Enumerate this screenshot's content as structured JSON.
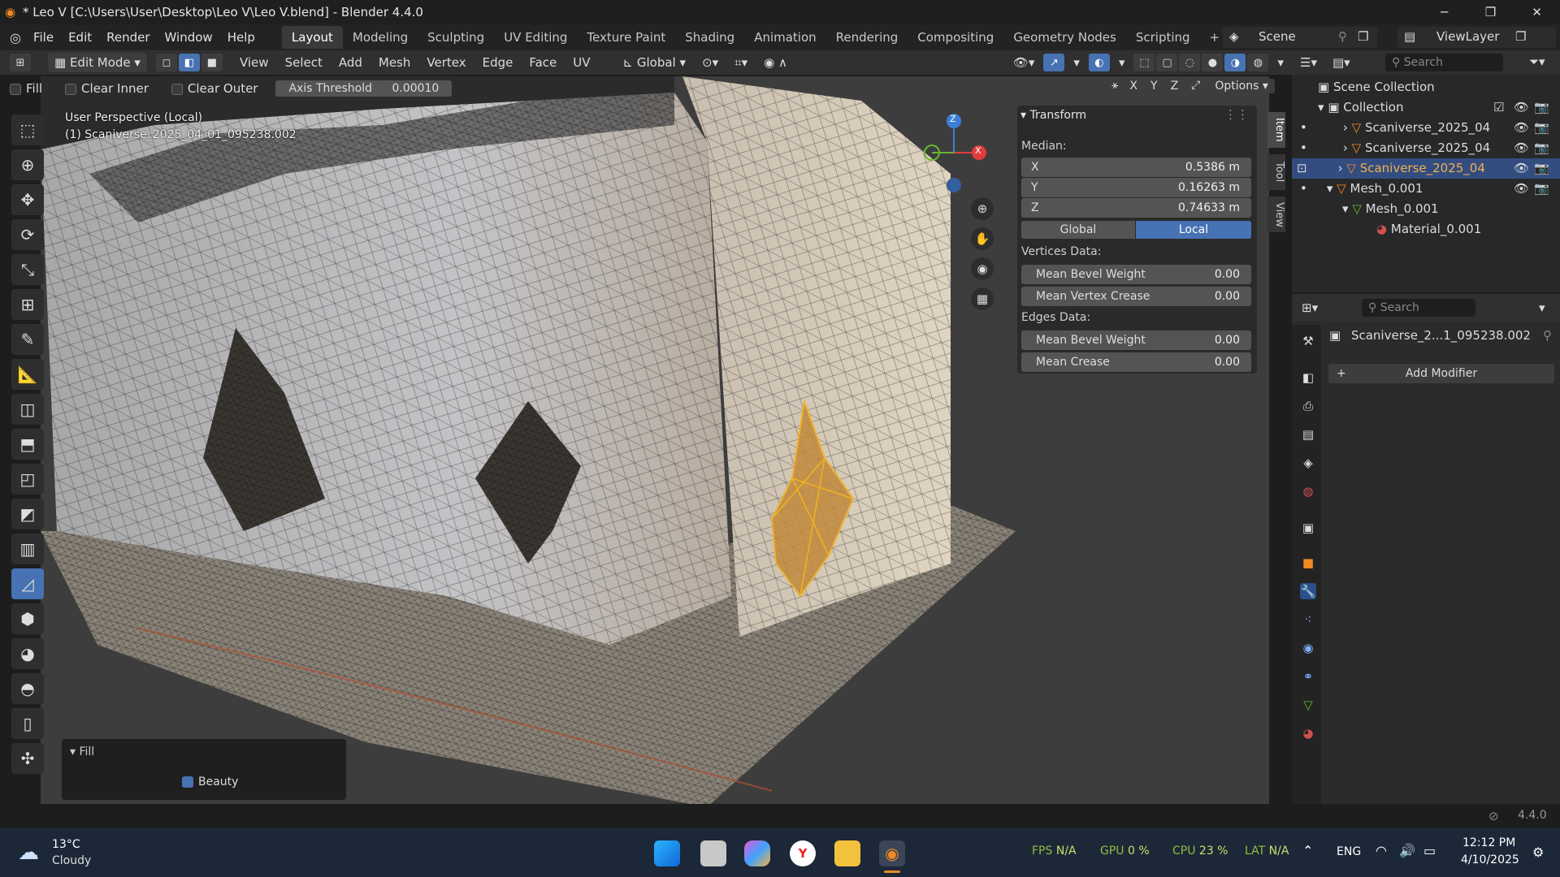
{
  "window": {
    "title": "* Leo V [C:\\Users\\User\\Desktop\\Leo V\\Leo V.blend] - Blender 4.4.0",
    "minimize": "─",
    "maximize": "❐",
    "close": "✕"
  },
  "menu": {
    "items": [
      "File",
      "Edit",
      "Render",
      "Window",
      "Help"
    ],
    "workspaces": [
      "Layout",
      "Modeling",
      "Sculpting",
      "UV Editing",
      "Texture Paint",
      "Shading",
      "Animation",
      "Rendering",
      "Compositing",
      "Geometry Nodes",
      "Scripting"
    ],
    "active_workspace": "Layout",
    "scene": "Scene",
    "view_layer": "ViewLayer"
  },
  "header": {
    "mode": "Edit Mode",
    "menus": [
      "View",
      "Select",
      "Add",
      "Mesh",
      "Vertex",
      "Edge",
      "Face",
      "UV"
    ],
    "orientation": "Global"
  },
  "fill_options": {
    "fill": "Fill",
    "clear_inner": "Clear Inner",
    "clear_outer": "Clear Outer",
    "axis_threshold_label": "Axis Threshold",
    "axis_threshold_value": "0.00010",
    "axes": [
      "X",
      "Y",
      "Z"
    ],
    "options": "Options"
  },
  "viewport": {
    "perspective": "User Perspective (Local)",
    "object": "(1) Scaniverse_2025_04_01_095238.002"
  },
  "transform_panel": {
    "title": "Transform",
    "median": "Median:",
    "x_label": "X",
    "x_value": "0.5386 m",
    "y_label": "Y",
    "y_value": "0.16263 m",
    "z_label": "Z",
    "z_value": "0.74633 m",
    "global": "Global",
    "local": "Local",
    "vertices_data": "Vertices Data:",
    "mean_bevel_weight": "Mean Bevel Weight",
    "mean_bevel_weight_v": "0.00",
    "mean_vertex_crease": "Mean Vertex Crease",
    "mean_vertex_crease_v": "0.00",
    "edges_data": "Edges Data:",
    "edge_bevel_weight": "Mean Bevel Weight",
    "edge_bevel_weight_v": "0.00",
    "mean_crease": "Mean Crease",
    "mean_crease_v": "0.00"
  },
  "sidetabs": [
    "Item",
    "Tool",
    "View"
  ],
  "fill_operator": {
    "title": "Fill",
    "beauty": "Beauty"
  },
  "outliner": {
    "search": "Search",
    "scene_collection": "Scene Collection",
    "collection": "Collection",
    "items": [
      "Scaniverse_2025_04",
      "Scaniverse_2025_04",
      "Scaniverse_2025_04"
    ],
    "mesh_obj": "Mesh_0.001",
    "mesh_data": "Mesh_0.001",
    "material": "Material_0.001"
  },
  "properties": {
    "search": "Search",
    "object_name": "Scaniverse_2...1_095238.002",
    "add_modifier": "Add Modifier"
  },
  "status": {
    "version": "4.4.0"
  },
  "taskbar": {
    "temp": "13°C",
    "weather": "Cloudy",
    "fps_label": "FPS",
    "fps": "N/A",
    "gpu_label": "GPU",
    "gpu": "0 %",
    "cpu_label": "CPU",
    "cpu": "23 %",
    "lat_label": "LAT",
    "lat": "N/A",
    "lang": "ENG",
    "time": "12:12 PM",
    "date": "4/10/2025"
  },
  "colors": {
    "accent": "#4772b3",
    "selection": "#f2b21f",
    "axis_x": "#e23c3c",
    "axis_y": "#6bb82f",
    "axis_z": "#3b7fd8"
  }
}
